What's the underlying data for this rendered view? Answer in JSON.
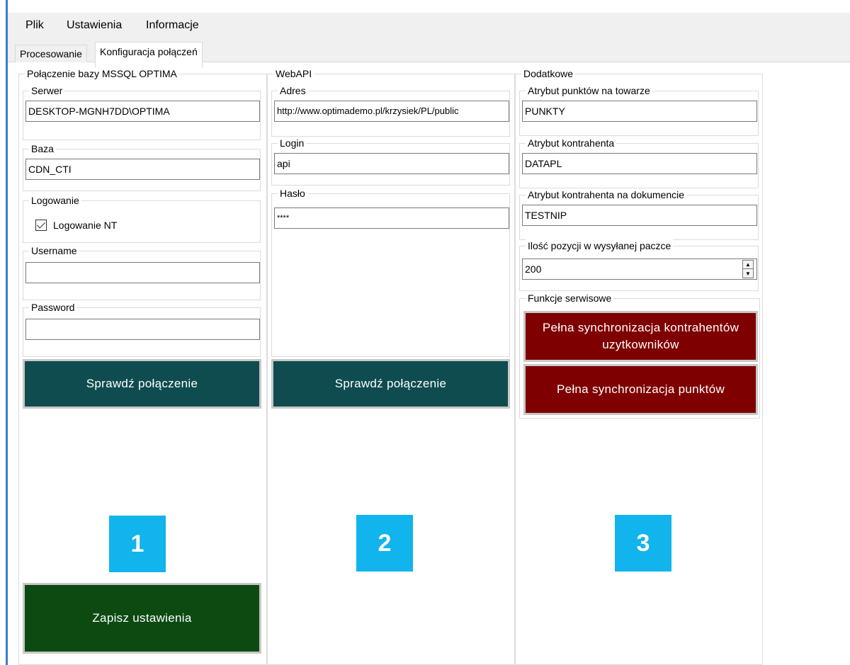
{
  "menu": {
    "items": [
      "Plik",
      "Ustawienia",
      "Informacje"
    ]
  },
  "tabs": {
    "processing": "Procesowanie",
    "config": "Konfiguracja połączeń"
  },
  "mssql": {
    "title": "Połączenie bazy MSSQL OPTIMA",
    "server_label": "Serwer",
    "server_value": "DESKTOP-MGNH7DD\\OPTIMA",
    "db_label": "Baza",
    "db_value": "CDN_CTI",
    "login_group_label": "Logowanie",
    "nt_login_label": "Logowanie NT",
    "nt_login_checked": true,
    "username_label": "Username",
    "username_value": "",
    "password_label": "Password",
    "password_value": "",
    "check_button": "Sprawdź połączenie",
    "badge": "1",
    "save_button": "Zapisz ustawienia"
  },
  "webapi": {
    "title": "WebAPI",
    "address_label": "Adres",
    "address_value": "http://www.optimademo.pl/krzysiek/PL/public",
    "login_label": "Login",
    "login_value": "api",
    "password_label": "Hasło",
    "password_value": "****",
    "check_button": "Sprawdź połączenie",
    "badge": "2"
  },
  "extra": {
    "title": "Dodatkowe",
    "points_attr_label": "Atrybut punktów na towarze",
    "points_attr_value": "PUNKTY",
    "contractor_attr_label": "Atrybut kontrahenta",
    "contractor_attr_value": "DATAPL",
    "doc_contractor_attr_label": "Atrybut kontrahenta na dokumencie",
    "doc_contractor_attr_value": "TESTNIP",
    "batch_size_label": "Ilość pozycji w wysyłanej paczce",
    "batch_size_value": "200",
    "service_title": "Funkcje serwisowe",
    "sync_contractors_button": "Pełna synchronizacja kontrahentów uzytkowników",
    "sync_points_button": "Pełna synchronizacja punktów",
    "badge": "3"
  },
  "colors": {
    "teal_button": "#0f4c4f",
    "red_button": "#7f0000",
    "green_button": "#0d4a12",
    "badge": "#11b4ec"
  }
}
